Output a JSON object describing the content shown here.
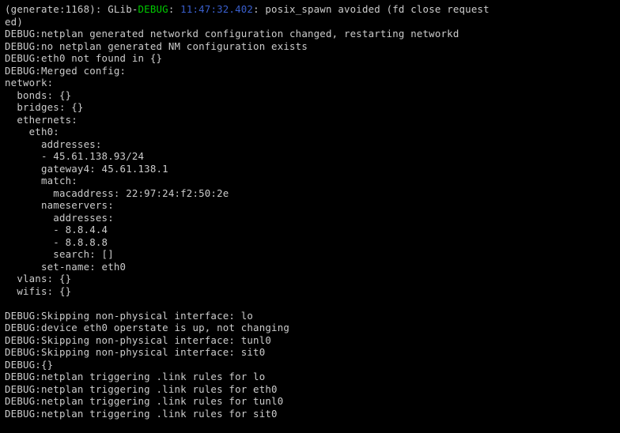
{
  "line0_prefix": "(generate:1168): GLib-",
  "line0_debug": "DEBUG",
  "line0_colon": ": ",
  "line0_time": "11:47:32.402",
  "line0_rest": ": posix_spawn avoided (fd close request",
  "line1": "ed)",
  "line2": "DEBUG:netplan generated networkd configuration changed, restarting networkd",
  "line3": "DEBUG:no netplan generated NM configuration exists",
  "line4": "DEBUG:eth0 not found in {}",
  "line5": "DEBUG:Merged config:",
  "line6": "network:",
  "line7": "  bonds: {}",
  "line8": "  bridges: {}",
  "line9": "  ethernets:",
  "line10": "    eth0:",
  "line11": "      addresses:",
  "line12": "      - 45.61.138.93/24",
  "line13": "      gateway4: 45.61.138.1",
  "line14": "      match:",
  "line15": "        macaddress: 22:97:24:f2:50:2e",
  "line16": "      nameservers:",
  "line17": "        addresses:",
  "line18": "        - 8.8.4.4",
  "line19": "        - 8.8.8.8",
  "line20": "        search: []",
  "line21": "      set-name: eth0",
  "line22": "  vlans: {}",
  "line23": "  wifis: {}",
  "line24": "",
  "line25": "DEBUG:Skipping non-physical interface: lo",
  "line26": "DEBUG:device eth0 operstate is up, not changing",
  "line27": "DEBUG:Skipping non-physical interface: tunl0",
  "line28": "DEBUG:Skipping non-physical interface: sit0",
  "line29": "DEBUG:{}",
  "line30": "DEBUG:netplan triggering .link rules for lo",
  "line31": "DEBUG:netplan triggering .link rules for eth0",
  "line32": "DEBUG:netplan triggering .link rules for tunl0",
  "line33": "DEBUG:netplan triggering .link rules for sit0"
}
